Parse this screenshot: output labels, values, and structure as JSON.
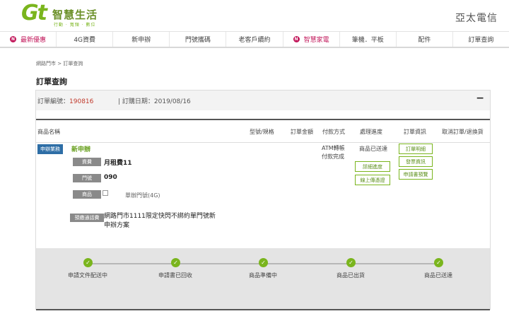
{
  "header": {
    "logo_mark": "Gt",
    "logo_title": "智慧生活",
    "logo_slogan": "行動 · 寬頻 · 數位",
    "brand_right": "亞太電信"
  },
  "nav": {
    "items": [
      {
        "label": "最新優惠",
        "badge": "N"
      },
      {
        "label": "4G資費"
      },
      {
        "label": "新申辦"
      },
      {
        "label": "門號攜碼"
      },
      {
        "label": "老客戶續約"
      },
      {
        "label": "智慧家電",
        "badge": "N"
      },
      {
        "label": "筆機．平板"
      },
      {
        "label": "配件"
      },
      {
        "label": "訂單查詢"
      }
    ]
  },
  "breadcrumb": "網路門市 > 訂單查詢",
  "page_title": "訂單查詢",
  "order": {
    "number_label": "訂單編號：",
    "number": "190816",
    "date_text": "| 訂購日期：2019/08/16",
    "collapse_symbol": "−",
    "columns": [
      "商品名稱",
      "型號/規格",
      "訂單金額",
      "付款方式",
      "處理進度",
      "訂單資訊",
      "取消訂單/退換貨"
    ],
    "item": {
      "category_tag": "申辦業務",
      "name": "新申辦",
      "rows": [
        {
          "label": "資費",
          "value": "月租費11"
        },
        {
          "label": "門號",
          "value": "090"
        },
        {
          "label": "商品",
          "value": "單辦門號(4G)"
        },
        {
          "label": "預繳通話費",
          "value": "網路門市1111限定快閃不綁約單門號新申辦方案"
        }
      ],
      "payment": [
        "ATM轉帳",
        "付款完成"
      ],
      "status": "商品已送達",
      "status_buttons": [
        "詳細進度",
        "線上傳憑證"
      ],
      "info_buttons": [
        "訂單明細",
        "發票資訊",
        "申請書預覽"
      ]
    },
    "progress_steps": [
      "申請文件配送中",
      "申請書已回收",
      "商品準備中",
      "商品已出貨",
      "商品已送達"
    ],
    "check_symbol": "✓"
  }
}
